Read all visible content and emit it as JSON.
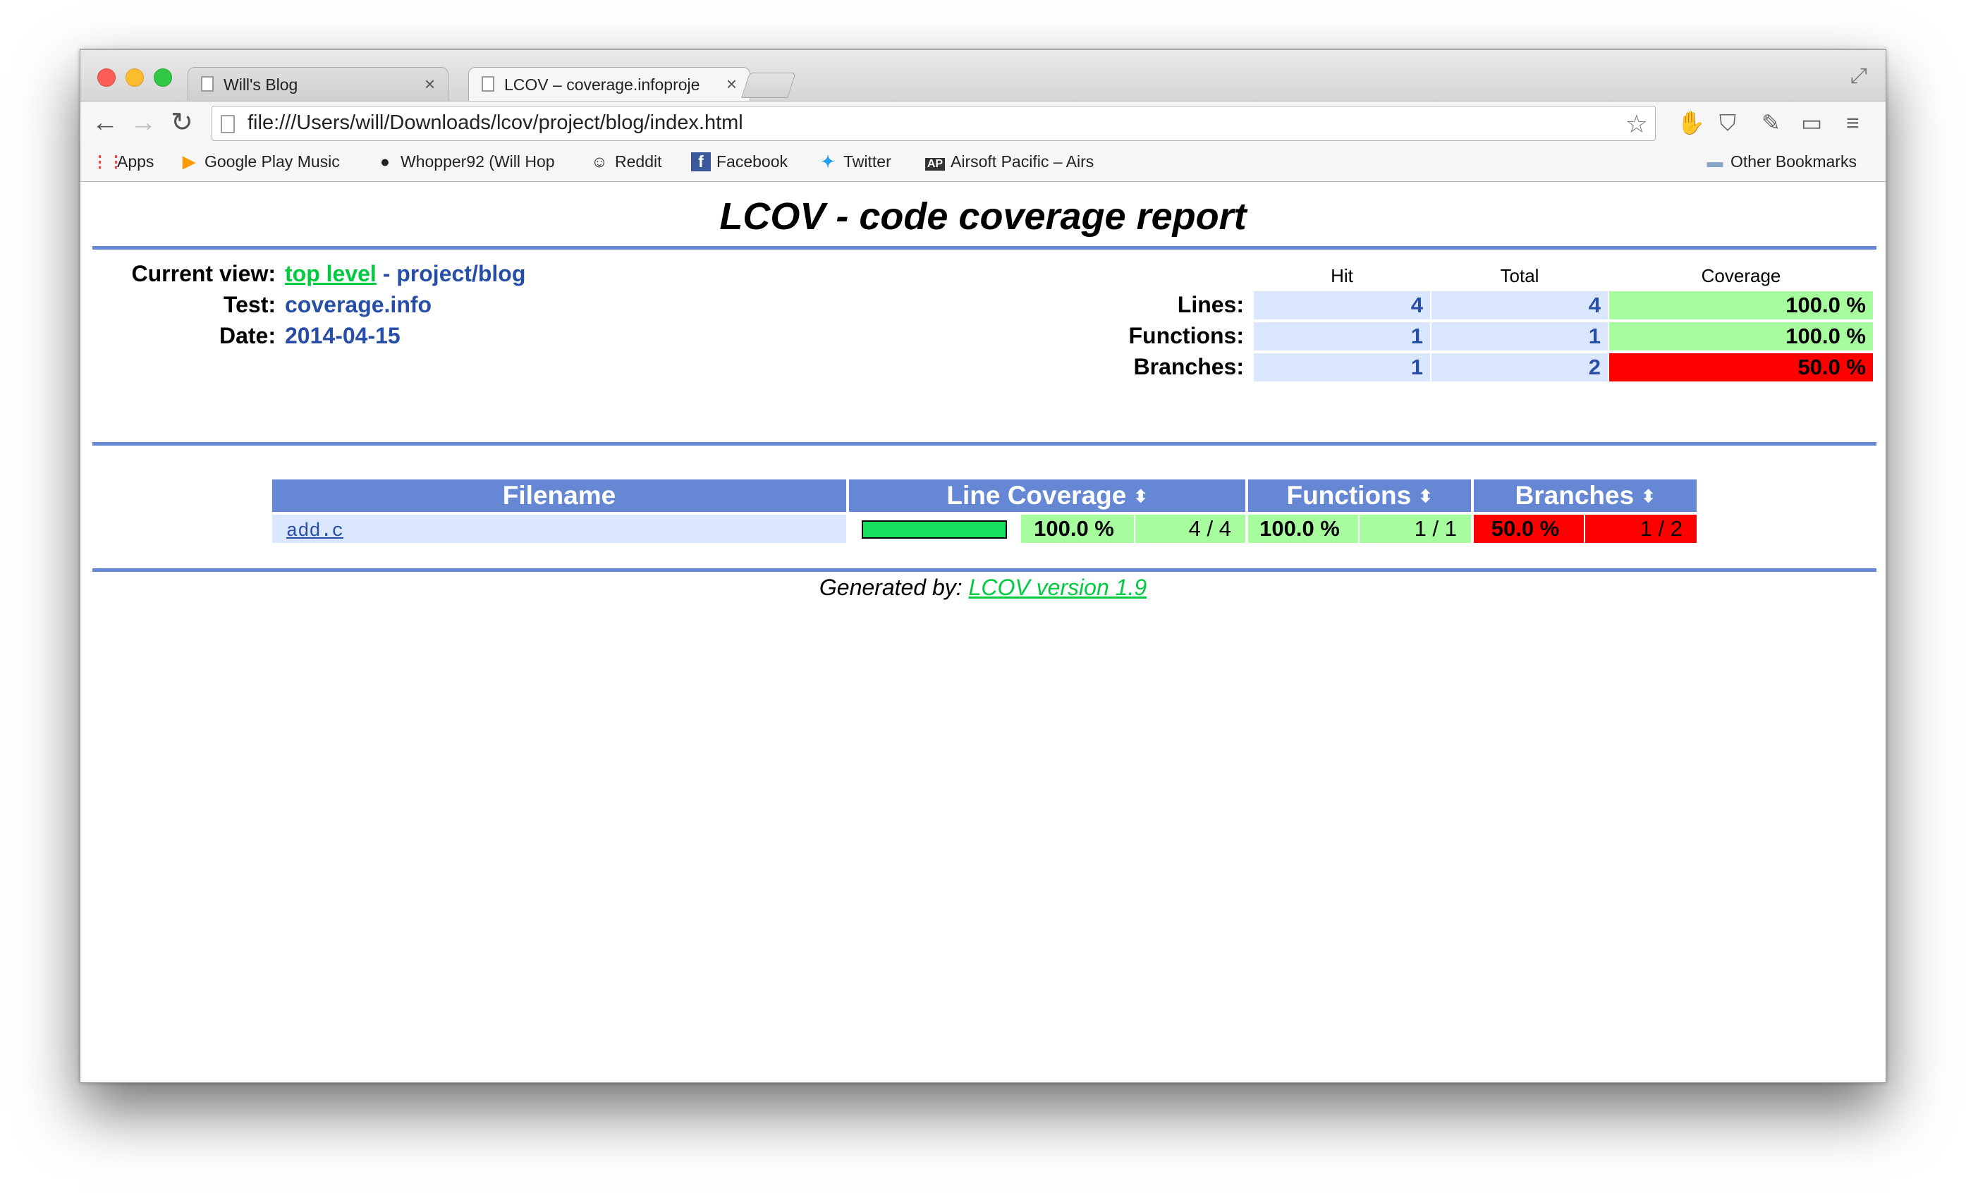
{
  "browser": {
    "tabs": [
      {
        "title": "Will's Blog",
        "close": "×"
      },
      {
        "title": "LCOV – coverage.infoproje",
        "close": "×"
      }
    ],
    "url": "file:///Users/will/Downloads/lcov/project/blog/index.html",
    "bookmarks": [
      {
        "label": "Apps",
        "icon": "apps-grid-icon"
      },
      {
        "label": "Google Play Music",
        "icon": "play-icon"
      },
      {
        "label": "Whopper92 (Will Hop",
        "icon": "github-icon"
      },
      {
        "label": "Reddit",
        "icon": "reddit-icon"
      },
      {
        "label": "Facebook",
        "icon": "facebook-icon"
      },
      {
        "label": "Twitter",
        "icon": "twitter-icon"
      },
      {
        "label": "Airsoft Pacific – Airs",
        "icon": "airsoft-icon"
      },
      {
        "label": "Other Bookmarks",
        "icon": "folder-icon"
      }
    ]
  },
  "report": {
    "title": "LCOV - code coverage report",
    "info": {
      "current_view_label": "Current view:",
      "top_level": "top level",
      "separator": " - ",
      "path": "project/blog",
      "test_label": "Test:",
      "test_value": "coverage.info",
      "date_label": "Date:",
      "date_value": "2014-04-15"
    },
    "summary": {
      "headers": {
        "hit": "Hit",
        "total": "Total",
        "coverage": "Coverage"
      },
      "rows": [
        {
          "label": "Lines:",
          "hit": "4",
          "total": "4",
          "coverage": "100.0 %",
          "status": "good"
        },
        {
          "label": "Functions:",
          "hit": "1",
          "total": "1",
          "coverage": "100.0 %",
          "status": "good"
        },
        {
          "label": "Branches:",
          "hit": "1",
          "total": "2",
          "coverage": "50.0 %",
          "status": "bad"
        }
      ]
    },
    "table": {
      "headers": {
        "filename": "Filename",
        "line": "Line Coverage",
        "functions": "Functions",
        "branches": "Branches"
      },
      "rows": [
        {
          "filename": "add.c",
          "line_fraction": 1.0,
          "line_pct": "100.0 %",
          "line_count": "4 / 4",
          "func_pct": "100.0 %",
          "func_count": "1 / 1",
          "branch_pct": "50.0 %",
          "branch_count": "1 / 2"
        }
      ]
    },
    "footer": {
      "prefix": "Generated by: ",
      "link": "LCOV version 1.9"
    }
  },
  "colors": {
    "ruler": "#6688d4",
    "good": "#a7fc9d",
    "bad": "#ff0000",
    "hitbg": "#dae7fe",
    "bar": "#18e05e"
  }
}
